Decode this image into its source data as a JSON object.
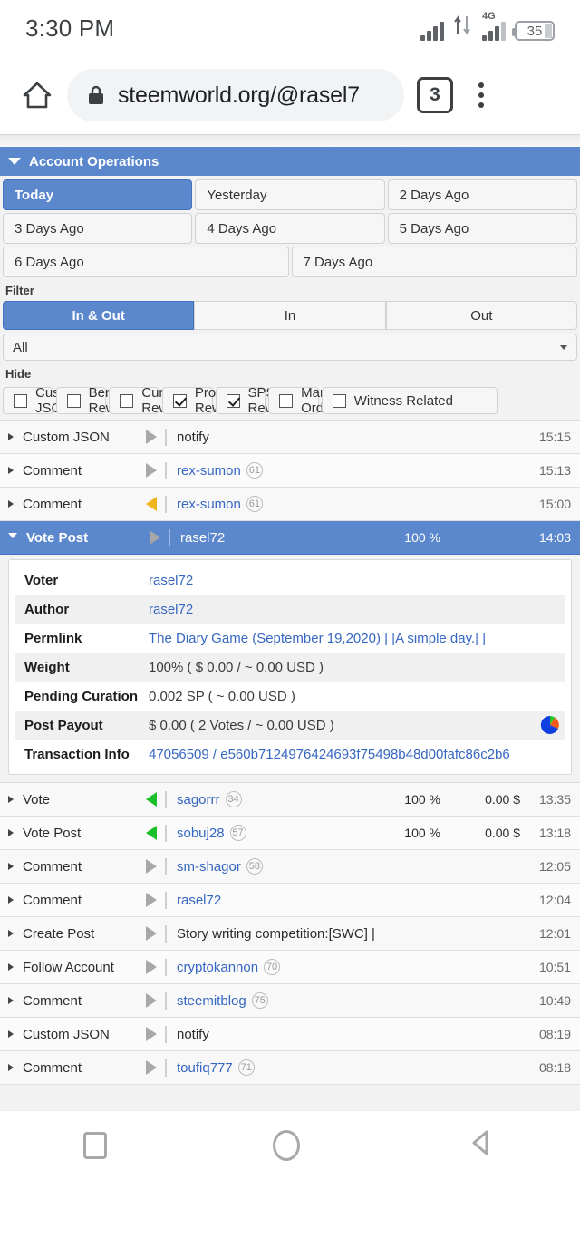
{
  "status_bar": {
    "time": "3:30 PM",
    "battery_level": "35",
    "network_type": "4G",
    "icons": [
      "signal-bars-icon",
      "data-transfer-icon",
      "signal-4g-icon",
      "battery-icon"
    ]
  },
  "browser": {
    "home_icon": "home-icon",
    "lock_icon": "lock-icon",
    "url": "steemworld.org/@rasel7",
    "tab_count": "3",
    "menu_icon": "kebab-menu-icon"
  },
  "panel": {
    "title": "Account Operations",
    "collapse_icon": "caret-down-icon"
  },
  "day_tabs": [
    {
      "label": "Today",
      "active": true
    },
    {
      "label": "Yesterday",
      "active": false
    },
    {
      "label": "2 Days Ago",
      "active": false
    },
    {
      "label": "3 Days Ago",
      "active": false
    },
    {
      "label": "4 Days Ago",
      "active": false
    },
    {
      "label": "5 Days Ago",
      "active": false
    },
    {
      "label": "6 Days Ago",
      "active": false
    },
    {
      "label": "7 Days Ago",
      "active": false
    }
  ],
  "filter": {
    "label": "Filter",
    "segments": [
      {
        "label": "In & Out",
        "active": true
      },
      {
        "label": "In",
        "active": false
      },
      {
        "label": "Out",
        "active": false
      }
    ],
    "select_value": "All"
  },
  "hide": {
    "label": "Hide",
    "options": [
      {
        "label": "Custom JSON",
        "checked": false
      },
      {
        "label": "Benefactor Rewards",
        "checked": false
      },
      {
        "label": "Curation Rewards",
        "checked": false
      },
      {
        "label": "Producer Rewards",
        "checked": true
      },
      {
        "label": "SPS Rewards",
        "checked": true
      },
      {
        "label": "Market Orders",
        "checked": false
      },
      {
        "label": "Witness Related",
        "checked": false
      }
    ]
  },
  "operations_top": [
    {
      "type": "Custom JSON",
      "direction": "out",
      "target": "notify",
      "target_link": false,
      "rep": "",
      "pct": "",
      "amount": "",
      "time": "15:15"
    },
    {
      "type": "Comment",
      "direction": "out",
      "target": "rex-sumon",
      "target_link": true,
      "rep": "61",
      "pct": "",
      "amount": "",
      "time": "15:13"
    },
    {
      "type": "Comment",
      "direction": "in-amber",
      "target": "rex-sumon",
      "target_link": true,
      "rep": "61",
      "pct": "",
      "amount": "",
      "time": "15:00"
    }
  ],
  "selected_operation": {
    "type": "Vote Post",
    "direction": "out",
    "target": "rasel72",
    "pct": "100 %",
    "time": "14:03",
    "details": [
      {
        "key": "Voter",
        "value": "rasel72",
        "link": true
      },
      {
        "key": "Author",
        "value": "rasel72",
        "link": true
      },
      {
        "key": "Permlink",
        "value": "The Diary Game (September 19,2020) | |A simple day.| |",
        "link": true
      },
      {
        "key": "Weight",
        "value": "100% ( $ 0.00 / ~ 0.00 USD )",
        "link": false
      },
      {
        "key": "Pending Curation",
        "value": "0.002 SP ( ~ 0.00 USD )",
        "link": false
      },
      {
        "key": "Post Payout",
        "value": "$ 0.00 ( 2 Votes / ~ 0.00 USD )",
        "link": false,
        "icon": "pie-chart-icon"
      },
      {
        "key": "Transaction Info",
        "value": "47056509 / e560b7124976424693f75498b48d00fafc86c2b6",
        "link": true
      }
    ]
  },
  "operations_bottom": [
    {
      "type": "Vote",
      "direction": "in-green",
      "target": "sagorrr",
      "target_link": true,
      "rep": "34",
      "pct": "100 %",
      "amount": "0.00 $",
      "time": "13:35"
    },
    {
      "type": "Vote Post",
      "direction": "in-green",
      "target": "sobuj28",
      "target_link": true,
      "rep": "57",
      "pct": "100 %",
      "amount": "0.00 $",
      "time": "13:18"
    },
    {
      "type": "Comment",
      "direction": "out",
      "target": "sm-shagor",
      "target_link": true,
      "rep": "58",
      "pct": "",
      "amount": "",
      "time": "12:05"
    },
    {
      "type": "Comment",
      "direction": "out",
      "target": "rasel72",
      "target_link": true,
      "rep": "",
      "pct": "",
      "amount": "",
      "time": "12:04"
    },
    {
      "type": "Create Post",
      "direction": "out",
      "target": "Story writing competition:[SWC] | |My Edu...",
      "target_link": false,
      "rep": "",
      "pct": "",
      "amount": "",
      "time": "12:01"
    },
    {
      "type": "Follow Account",
      "direction": "out",
      "target": "cryptokannon",
      "target_link": true,
      "rep": "70",
      "pct": "",
      "amount": "",
      "time": "10:51"
    },
    {
      "type": "Comment",
      "direction": "out",
      "target": "steemitblog",
      "target_link": true,
      "rep": "75",
      "pct": "",
      "amount": "",
      "time": "10:49"
    },
    {
      "type": "Custom JSON",
      "direction": "out",
      "target": "notify",
      "target_link": false,
      "rep": "",
      "pct": "",
      "amount": "",
      "time": "08:19"
    },
    {
      "type": "Comment",
      "direction": "out",
      "target": "toufiq777",
      "target_link": true,
      "rep": "71",
      "pct": "",
      "amount": "",
      "time": "08:18"
    }
  ],
  "nav_bar": {
    "recents": "recents-square-icon",
    "home": "home-circle-icon",
    "back": "back-triangle-icon"
  },
  "colors": {
    "accent_blue": "#5b87cd",
    "link_blue": "#3667c2",
    "in_green": "#1bbf2a",
    "in_amber": "#f0b41e"
  }
}
